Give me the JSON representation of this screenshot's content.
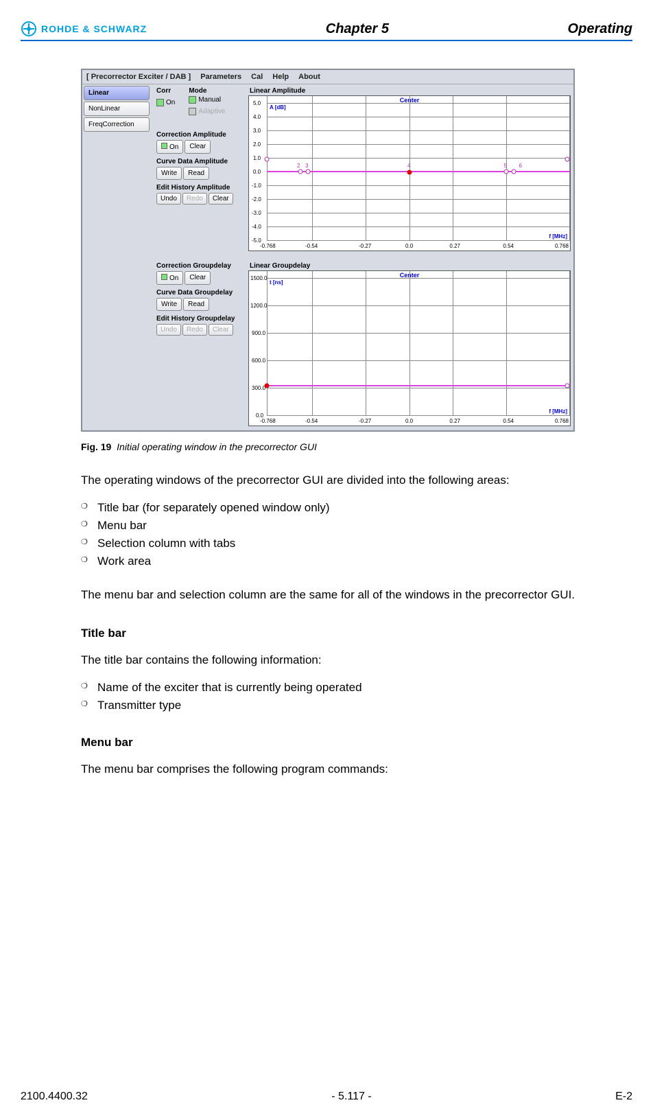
{
  "header": {
    "brand": "ROHDE & SCHWARZ",
    "chapter": "Chapter 5",
    "right": "Operating"
  },
  "ss": {
    "title": "[ Precorrector Exciter / DAB ]",
    "menus": [
      "Parameters",
      "Cal",
      "Help",
      "About"
    ],
    "tabs": [
      "Linear",
      "NonLinear",
      "FreqCorrection"
    ],
    "corr": {
      "label": "Corr",
      "on": "On"
    },
    "mode": {
      "label": "Mode",
      "manual": "Manual",
      "adaptive": "Adaptive"
    },
    "corrAmp": {
      "label": "Correction Amplitude",
      "on": "On",
      "clear": "Clear"
    },
    "curveAmp": {
      "label": "Curve Data Amplitude",
      "write": "Write",
      "read": "Read"
    },
    "histAmp": {
      "label": "Edit History Amplitude",
      "undo": "Undo",
      "redo": "Redo",
      "clear": "Clear"
    },
    "corrGd": {
      "label": "Correction Groupdelay",
      "on": "On",
      "clear": "Clear"
    },
    "curveGd": {
      "label": "Curve Data Groupdelay",
      "write": "Write",
      "read": "Read"
    },
    "histGd": {
      "label": "Edit History Groupdelay",
      "undo": "Undo",
      "redo": "Redo",
      "clear": "Clear"
    },
    "chart1": {
      "title": "Linear Amplitude",
      "ylabel": "A [dB]",
      "xlabel": "f [MHz]",
      "center": "Center"
    },
    "chart2": {
      "title": "Linear Groupdelay",
      "ylabel": "t [ns]",
      "xlabel": "f [MHz]",
      "center": "Center"
    }
  },
  "chart_data": [
    {
      "type": "line",
      "title": "Linear Amplitude",
      "xlabel": "f [MHz]",
      "ylabel": "A [dB]",
      "xlim": [
        -0.768,
        0.768
      ],
      "ylim": [
        -5.0,
        5.0
      ],
      "xticks": [
        -0.768,
        -0.54,
        -0.27,
        0.0,
        0.27,
        0.54,
        0.768
      ],
      "yticks": [
        -5.0,
        -4.0,
        -3.0,
        -2.0,
        -1.0,
        0.0,
        1.0,
        2.0,
        3.0,
        4.0,
        5.0
      ],
      "series": [
        {
          "name": "curve",
          "x": [
            -0.768,
            -0.6,
            -0.55,
            0.0,
            0.55,
            0.6,
            0.768
          ],
          "y": [
            0.9,
            0.0,
            0.0,
            0.0,
            0.0,
            0.0,
            0.9
          ]
        }
      ],
      "markers": [
        {
          "n": 1,
          "x": -0.768,
          "y": 0.9
        },
        {
          "n": 2,
          "x": -0.6,
          "y": 0.0
        },
        {
          "n": 3,
          "x": -0.55,
          "y": 0.0
        },
        {
          "n": 4,
          "x": 0.0,
          "y": 0.0
        },
        {
          "n": 5,
          "x": 0.55,
          "y": 0.0
        },
        {
          "n": 6,
          "x": 0.6,
          "y": 0.0
        },
        {
          "n": 7,
          "x": 0.768,
          "y": 0.9
        }
      ]
    },
    {
      "type": "line",
      "title": "Linear Groupdelay",
      "xlabel": "f [MHz]",
      "ylabel": "t [ns]",
      "xlim": [
        -0.768,
        0.768
      ],
      "ylim": [
        0.0,
        1500.0
      ],
      "xticks": [
        -0.768,
        -0.54,
        -0.27,
        0.0,
        0.27,
        0.54,
        0.768
      ],
      "yticks": [
        0.0,
        300.0,
        600.0,
        900.0,
        1200.0,
        1500.0
      ],
      "series": [
        {
          "name": "curve",
          "x": [
            -0.768,
            0.768
          ],
          "y": [
            320,
            320
          ]
        }
      ],
      "markers": [
        {
          "n": 1,
          "x": -0.768,
          "y": 320
        },
        {
          "n": 2,
          "x": 0.768,
          "y": 320
        }
      ]
    }
  ],
  "caption": {
    "num": "Fig. 19",
    "text": "Initial operating window in the precorrector GUI"
  },
  "p1": "The operating windows of the precorrector GUI are divided into the following areas:",
  "list1": [
    "Title bar (for separately opened window only)",
    "Menu bar",
    "Selection column with tabs",
    "Work area"
  ],
  "p2": "The menu bar and selection column are the same for all of the windows in the precorrector GUI.",
  "h_title": "Title bar",
  "p3": "The title bar contains the following information:",
  "list2": [
    "Name of the exciter that is currently being operated",
    "Transmitter type"
  ],
  "h_menu": "Menu bar",
  "p4": "The menu bar comprises the following program commands:",
  "footer": {
    "left": "2100.4400.32",
    "center": "- 5.117 -",
    "right": "E-2"
  }
}
